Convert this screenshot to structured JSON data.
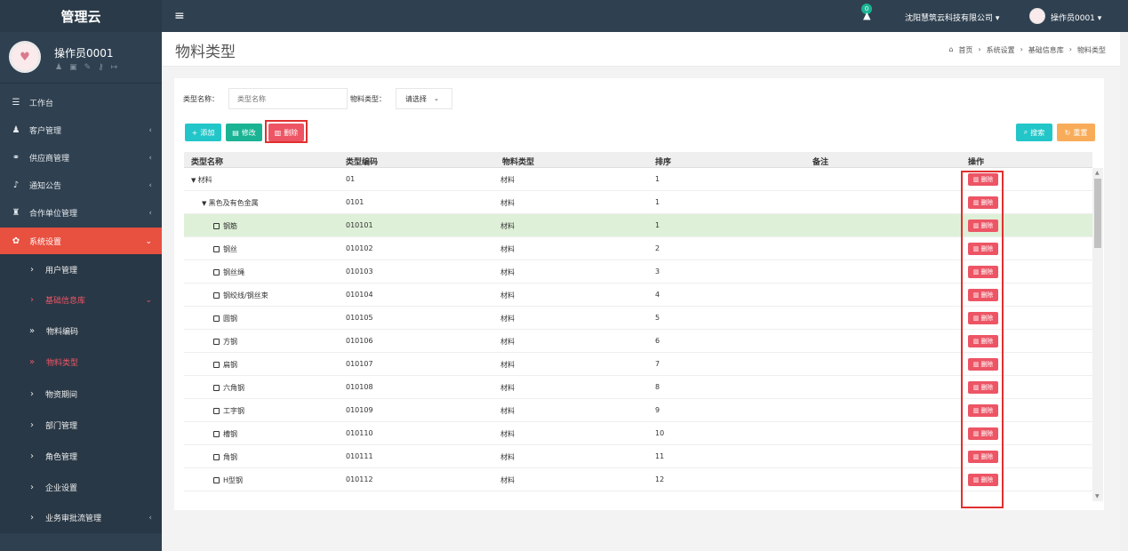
{
  "app": {
    "logo": "管理云"
  },
  "profile": {
    "name": "操作员0001",
    "avatar_glyph": "♥"
  },
  "topbar": {
    "notif_count": "0",
    "company": "沈阳慧筑云科技有限公司 ▾",
    "operator": "操作员0001 ▾"
  },
  "sidebar": {
    "items": [
      {
        "label": "工作台",
        "icon": "☰",
        "arrow": ""
      },
      {
        "label": "客户管理",
        "icon": "♟",
        "arrow": "‹"
      },
      {
        "label": "供应商管理",
        "icon": "⚭",
        "arrow": "‹"
      },
      {
        "label": "通知公告",
        "icon": "♪",
        "arrow": "‹"
      },
      {
        "label": "合作单位管理",
        "icon": "♜",
        "arrow": "‹"
      },
      {
        "label": "系统设置",
        "icon": "✿",
        "arrow": "⌄"
      },
      {
        "label": "用户管理",
        "icon": "›",
        "arrow": ""
      },
      {
        "label": "基础信息库",
        "icon": "›",
        "arrow": "⌄"
      },
      {
        "label": "物料编码",
        "icon": "»",
        "arrow": ""
      },
      {
        "label": "物料类型",
        "icon": "»",
        "arrow": ""
      },
      {
        "label": "物资期间",
        "icon": "›",
        "arrow": ""
      },
      {
        "label": "部门管理",
        "icon": "›",
        "arrow": ""
      },
      {
        "label": "角色管理",
        "icon": "›",
        "arrow": ""
      },
      {
        "label": "企业设置",
        "icon": "›",
        "arrow": ""
      },
      {
        "label": "业务审批流管理",
        "icon": "›",
        "arrow": "‹"
      }
    ]
  },
  "page": {
    "title": "物料类型"
  },
  "breadcrumb": [
    "首页",
    "›",
    "系统设置",
    "›",
    "基础信息库",
    "›",
    "物料类型"
  ],
  "filters": {
    "name_label": "类型名称：",
    "name_placeholder": "类型名称",
    "type_label": "物料类型：",
    "type_value": "请选择"
  },
  "toolbar": {
    "add": "添加",
    "edit": "修改",
    "delete": "删除",
    "search": "搜索",
    "reset": "重置"
  },
  "table": {
    "headers": [
      "类型名称",
      "类型编码",
      "物料类型",
      "排序",
      "备注",
      "操作"
    ],
    "delete_label": "删除",
    "rows": [
      {
        "name": "材料",
        "code": "01",
        "type": "材料",
        "sort": "1",
        "level": 0,
        "mark": "▼"
      },
      {
        "name": "黑色及有色金属",
        "code": "0101",
        "type": "材料",
        "sort": "1",
        "level": 1,
        "mark": "▼"
      },
      {
        "name": "钢筋",
        "code": "010101",
        "type": "材料",
        "sort": "1",
        "level": 2,
        "mark": "sq"
      },
      {
        "name": "钢丝",
        "code": "010102",
        "type": "材料",
        "sort": "2",
        "level": 2,
        "mark": "sq"
      },
      {
        "name": "钢丝绳",
        "code": "010103",
        "type": "材料",
        "sort": "3",
        "level": 2,
        "mark": "sq"
      },
      {
        "name": "钢绞线/钢丝束",
        "code": "010104",
        "type": "材料",
        "sort": "4",
        "level": 2,
        "mark": "sq"
      },
      {
        "name": "圆钢",
        "code": "010105",
        "type": "材料",
        "sort": "5",
        "level": 2,
        "mark": "sq"
      },
      {
        "name": "方钢",
        "code": "010106",
        "type": "材料",
        "sort": "6",
        "level": 2,
        "mark": "sq"
      },
      {
        "name": "扁钢",
        "code": "010107",
        "type": "材料",
        "sort": "7",
        "level": 2,
        "mark": "sq"
      },
      {
        "name": "六角钢",
        "code": "010108",
        "type": "材料",
        "sort": "8",
        "level": 2,
        "mark": "sq"
      },
      {
        "name": "工字钢",
        "code": "010109",
        "type": "材料",
        "sort": "9",
        "level": 2,
        "mark": "sq"
      },
      {
        "name": "槽钢",
        "code": "010110",
        "type": "材料",
        "sort": "10",
        "level": 2,
        "mark": "sq"
      },
      {
        "name": "角钢",
        "code": "010111",
        "type": "材料",
        "sort": "11",
        "level": 2,
        "mark": "sq"
      },
      {
        "name": "H型钢",
        "code": "010112",
        "type": "材料",
        "sort": "12",
        "level": 2,
        "mark": "sq"
      }
    ]
  }
}
